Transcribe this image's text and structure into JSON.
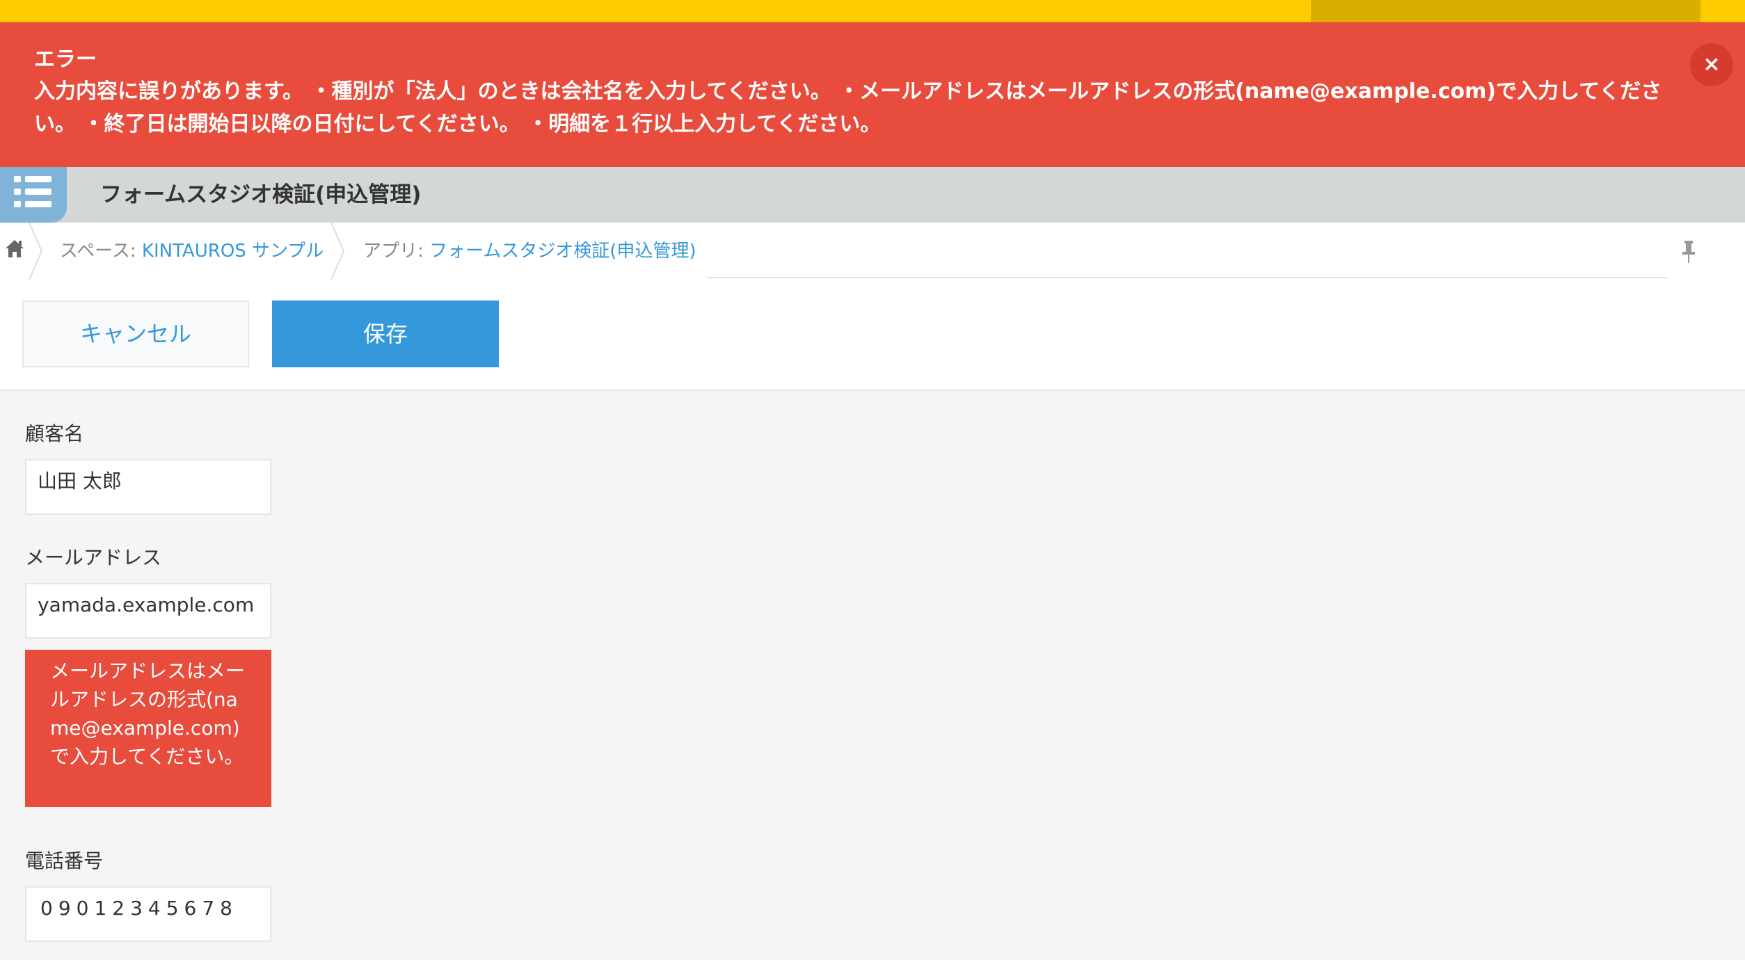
{
  "error_banner": {
    "title": "エラー",
    "message": "入力内容に誤りがあります。 ・種別が「法人」のときは会社名を入力してください。 ・メールアドレスはメールアドレスの形式(name@example.com)で入力してください。 ・終了日は開始日以降の日付にしてください。 ・明細を１行以上入力してください。",
    "close_label": "×"
  },
  "app_header": {
    "title": "フォームスタジオ検証(申込管理)",
    "icon": "app-list-icon"
  },
  "breadcrumb": {
    "home_icon": "home-icon",
    "space_prefix": "スペース: ",
    "space_name": "KINTAUROS サンプル",
    "app_prefix": "アプリ: ",
    "app_name": "フォームスタジオ検証(申込管理)",
    "pin_icon": "pin-icon"
  },
  "toolbar": {
    "cancel_label": "キャンセル",
    "save_label": "保存"
  },
  "form": {
    "customer_name": {
      "label": "顧客名",
      "value": "山田 太郎"
    },
    "email": {
      "label": "メールアドレス",
      "value": "yamada.example.com",
      "error": "メールアドレスはメールアドレスの形式(name@example.com)で入力してください。"
    },
    "phone": {
      "label": "電話番号",
      "value": "09012345678"
    }
  },
  "colors": {
    "error_red": "#e74c3c",
    "accent_blue": "#3498db",
    "top_strip_yellow": "#ffcc00",
    "header_gray": "#d4d7d8"
  }
}
